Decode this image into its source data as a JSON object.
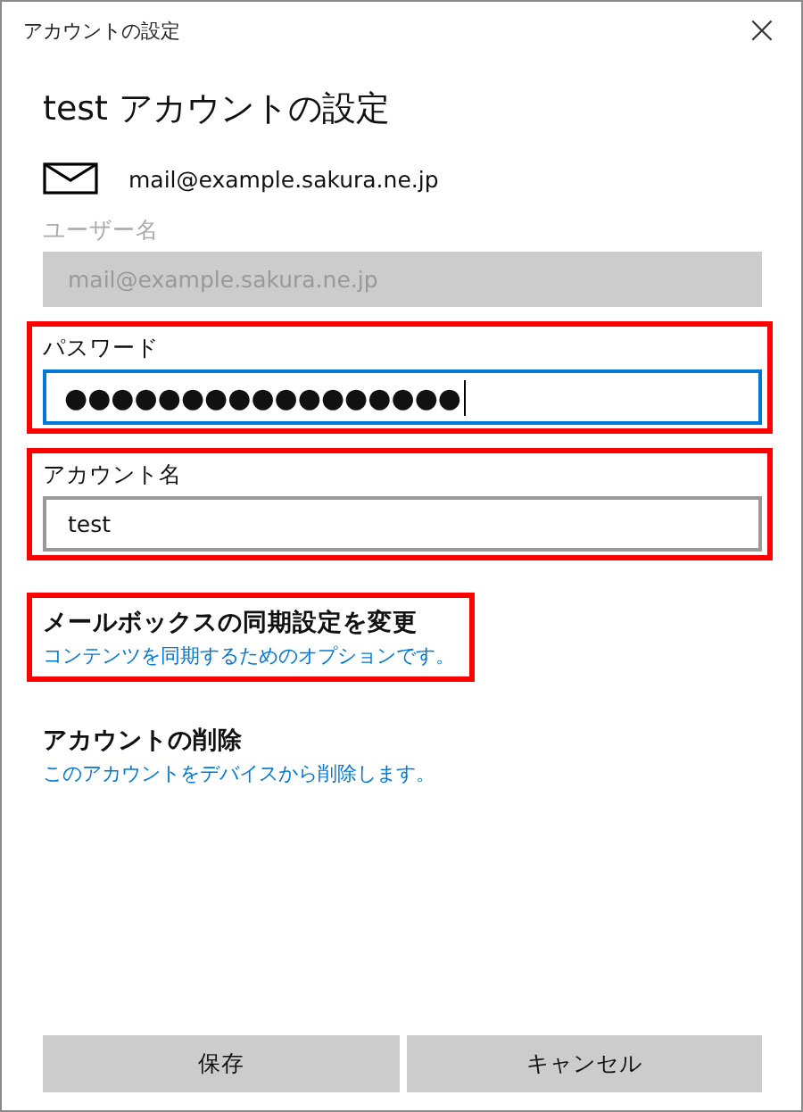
{
  "window": {
    "title": "アカウントの設定",
    "close": "×"
  },
  "heading": "test アカウントの設定",
  "email": "mail@example.sakura.ne.jp",
  "fields": [
    {
      "label": "ユーザー名",
      "value": "mail@example.sakura.ne.jp",
      "disabled": true,
      "focused": false,
      "highlighted": false
    },
    {
      "label": "パスワード",
      "value": "●●●●●●●●●●●●●●●●●",
      "disabled": false,
      "focused": true,
      "highlighted": true
    },
    {
      "label": "アカウント名",
      "value": "test",
      "disabled": false,
      "focused": false,
      "highlighted": true
    }
  ],
  "links": [
    {
      "title": "メールボックスの同期設定を変更",
      "description": "コンテンツを同期するためのオプションです。",
      "highlighted": true
    },
    {
      "title": "アカウントの削除",
      "description": "このアカウントをデバイスから削除します。",
      "highlighted": false
    }
  ],
  "buttons": [
    "保存",
    "キャンセル"
  ]
}
